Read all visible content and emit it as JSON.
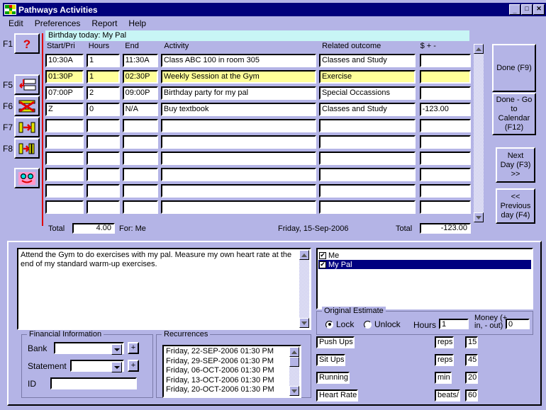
{
  "window": {
    "title": "Pathways Activities",
    "buttons": {
      "minimize": "_",
      "maximize": "□",
      "close": "✕"
    }
  },
  "menu": {
    "items": [
      "Edit",
      "Preferences",
      "Report",
      "Help"
    ]
  },
  "banner": {
    "text": "Birthday today: My Pal"
  },
  "fkeys": [
    {
      "key": "F1",
      "icon": "question-mark-icon"
    },
    {
      "key": "F5",
      "icon": "insert-rows-icon"
    },
    {
      "key": "F6",
      "icon": "delete-row-icon"
    },
    {
      "key": "F7",
      "icon": "move-right-icon"
    },
    {
      "key": "F8",
      "icon": "push-right-icon"
    },
    {
      "key": "",
      "icon": "smiley-face-icon"
    }
  ],
  "grid": {
    "headers": [
      "Start/Pri",
      "Hours",
      "End",
      "Activity",
      "Related outcome",
      "$ + -"
    ],
    "rows": [
      {
        "start": "10:30A",
        "hours": "1",
        "end": "11:30A",
        "activity": "Class ABC 100 in room 305",
        "outcome": "Classes and Study",
        "amount": "",
        "selected": false
      },
      {
        "start": "01:30P",
        "hours": "1",
        "end": "02:30P",
        "activity": "Weekly Session at the Gym",
        "outcome": "Exercise",
        "amount": "",
        "selected": true
      },
      {
        "start": "07:00P",
        "hours": "2",
        "end": "09:00P",
        "activity": "Birthday party for my pal",
        "outcome": "Special Occassions",
        "amount": "",
        "selected": false
      },
      {
        "start": "Z",
        "hours": "0",
        "end": "N/A",
        "activity": "Buy textbook",
        "outcome": "Classes and Study",
        "amount": "-123.00",
        "selected": false
      },
      {
        "start": "",
        "hours": "",
        "end": "",
        "activity": "",
        "outcome": "",
        "amount": "",
        "selected": false
      },
      {
        "start": "",
        "hours": "",
        "end": "",
        "activity": "",
        "outcome": "",
        "amount": "",
        "selected": false
      },
      {
        "start": "",
        "hours": "",
        "end": "",
        "activity": "",
        "outcome": "",
        "amount": "",
        "selected": false
      },
      {
        "start": "",
        "hours": "",
        "end": "",
        "activity": "",
        "outcome": "",
        "amount": "",
        "selected": false
      },
      {
        "start": "",
        "hours": "",
        "end": "",
        "activity": "",
        "outcome": "",
        "amount": "",
        "selected": false
      },
      {
        "start": "",
        "hours": "",
        "end": "",
        "activity": "",
        "outcome": "",
        "amount": "",
        "selected": false
      }
    ]
  },
  "totals": {
    "hours_label": "Total",
    "hours_value": "4.00",
    "for_label": "For: Me",
    "date": "Friday, 15-Sep-2006",
    "money_label": "Total",
    "money_value": "-123.00"
  },
  "right_buttons": [
    {
      "label": "Done (F9)"
    },
    {
      "label": "Done - Go\nto\nCalendar\n(F12)"
    },
    {
      "label": "Next\nDay (F3)\n>>"
    },
    {
      "label": "<<\nPrevious\nday (F4)"
    }
  ],
  "notes": {
    "text": "Attend the Gym to do exercises with my pal.  Measure my own heart rate at the end of my standard warm-up exercises."
  },
  "people": [
    {
      "label": "Me",
      "checked": "✔",
      "selected": false
    },
    {
      "label": "My Pal",
      "checked": "✔",
      "selected": true
    }
  ],
  "original_estimate": {
    "caption": "Original Estimate",
    "lock_label": "Lock",
    "unlock_label": "Unlock",
    "selected": "Lock",
    "hours_label": "Hours",
    "hours_value": "1",
    "money_label": "Money (+\nin, - out)",
    "money_value": "0"
  },
  "financial": {
    "caption": "Financial Information",
    "bank_label": "Bank",
    "bank_value": "",
    "statement_label": "Statement",
    "statement_value": "",
    "id_label": "ID",
    "id_value": "",
    "plus_label": "+"
  },
  "recurrences": {
    "caption": "Recurrences",
    "items": [
      "Friday, 22-SEP-2006 01:30 PM",
      "Friday, 29-SEP-2006 01:30 PM",
      "Friday, 06-OCT-2006 01:30 PM",
      "Friday, 13-OCT-2006 01:30 PM",
      "Friday, 20-OCT-2006 01:30 PM"
    ]
  },
  "measures": [
    {
      "name": "Push Ups",
      "unit": "reps",
      "value": "15"
    },
    {
      "name": "Sit Ups",
      "unit": "reps",
      "value": "45"
    },
    {
      "name": "Running",
      "unit": "min",
      "value": "20"
    },
    {
      "name": "Heart Rate",
      "unit": "beats/",
      "value": "60"
    }
  ],
  "colors": {
    "face": "#b4b4e6",
    "titlebar": "#00007b",
    "selection": "#000080",
    "highlight_row": "#ffff99",
    "banner": "#c8f5f5",
    "accent_red": "#e00000"
  }
}
